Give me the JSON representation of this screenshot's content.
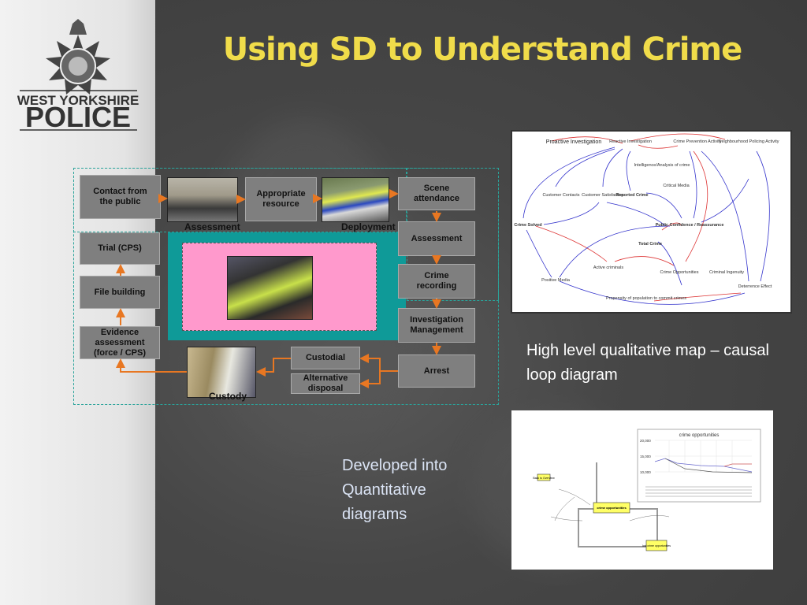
{
  "title": "Using SD to Understand Crime",
  "logo": {
    "line1": "WEST YORKSHIRE",
    "line2": "POLICE"
  },
  "process": {
    "contact": "Contact from the public",
    "assessment_photo_label": "Assessment",
    "appropriate": "Appropriate resource",
    "deployment_label": "Deployment",
    "scene": "Scene attendance",
    "assessment": "Assessment",
    "crime_recording": "Crime recording",
    "investigation": "Investigation Management",
    "arrest": "Arrest",
    "custodial": "Custodial",
    "alternative": "Alternative disposal",
    "custody_label": "Custody",
    "evidence": "Evidence assessment (force / CPS)",
    "file_building": "File building",
    "trial": "Trial (CPS)"
  },
  "colors": {
    "title": "#f0dc4a",
    "arrow": "#e87722",
    "teal": "#0f9a98",
    "pink": "#ff99cc",
    "box": "#7f7f7f"
  },
  "causal_loop": {
    "nodes": [
      "Proactive Investigation",
      "Reactive Investigation",
      "Crime Prevention Activity",
      "Neighbourhood Policing Activity",
      "Intelligence/Analysis of crime",
      "Critical Media",
      "Customer Contacts",
      "Customer Satisfaction",
      "Reported Crime",
      "Crime Solved",
      "Public Confidence / Reassurance",
      "Total Crime",
      "Active criminals",
      "Crime Opportunities",
      "Criminal Ingenuity",
      "Positive Media",
      "Propensity of population to commit crimes",
      "Deterrence Effect"
    ]
  },
  "caption_qualitative": "High level qualitative map – causal loop diagram",
  "caption_quantitative": "Developed into Quantitative diagrams",
  "quant": {
    "chart_title": "crime opportunities",
    "yticks": [
      "20,000",
      "15,000",
      "10,000"
    ],
    "stock1": "crime opportunities",
    "stock2": "lost crime opportunities",
    "back": "Back to Overview"
  }
}
